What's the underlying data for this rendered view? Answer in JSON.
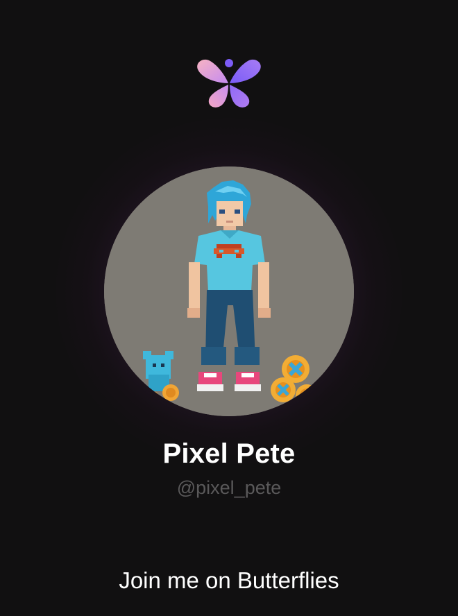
{
  "app": {
    "logo_icon": "butterflies-logo-icon",
    "accent_gradient": [
      "#f7b0c8",
      "#b07cf0",
      "#7c5cf6"
    ]
  },
  "profile": {
    "display_name": "Pixel Pete",
    "handle": "@pixel_pete",
    "avatar_icon": "pixel-art-avatar",
    "avatar_background": "#7e7b74"
  },
  "footer": {
    "cta_text": "Join me on Butterflies"
  }
}
